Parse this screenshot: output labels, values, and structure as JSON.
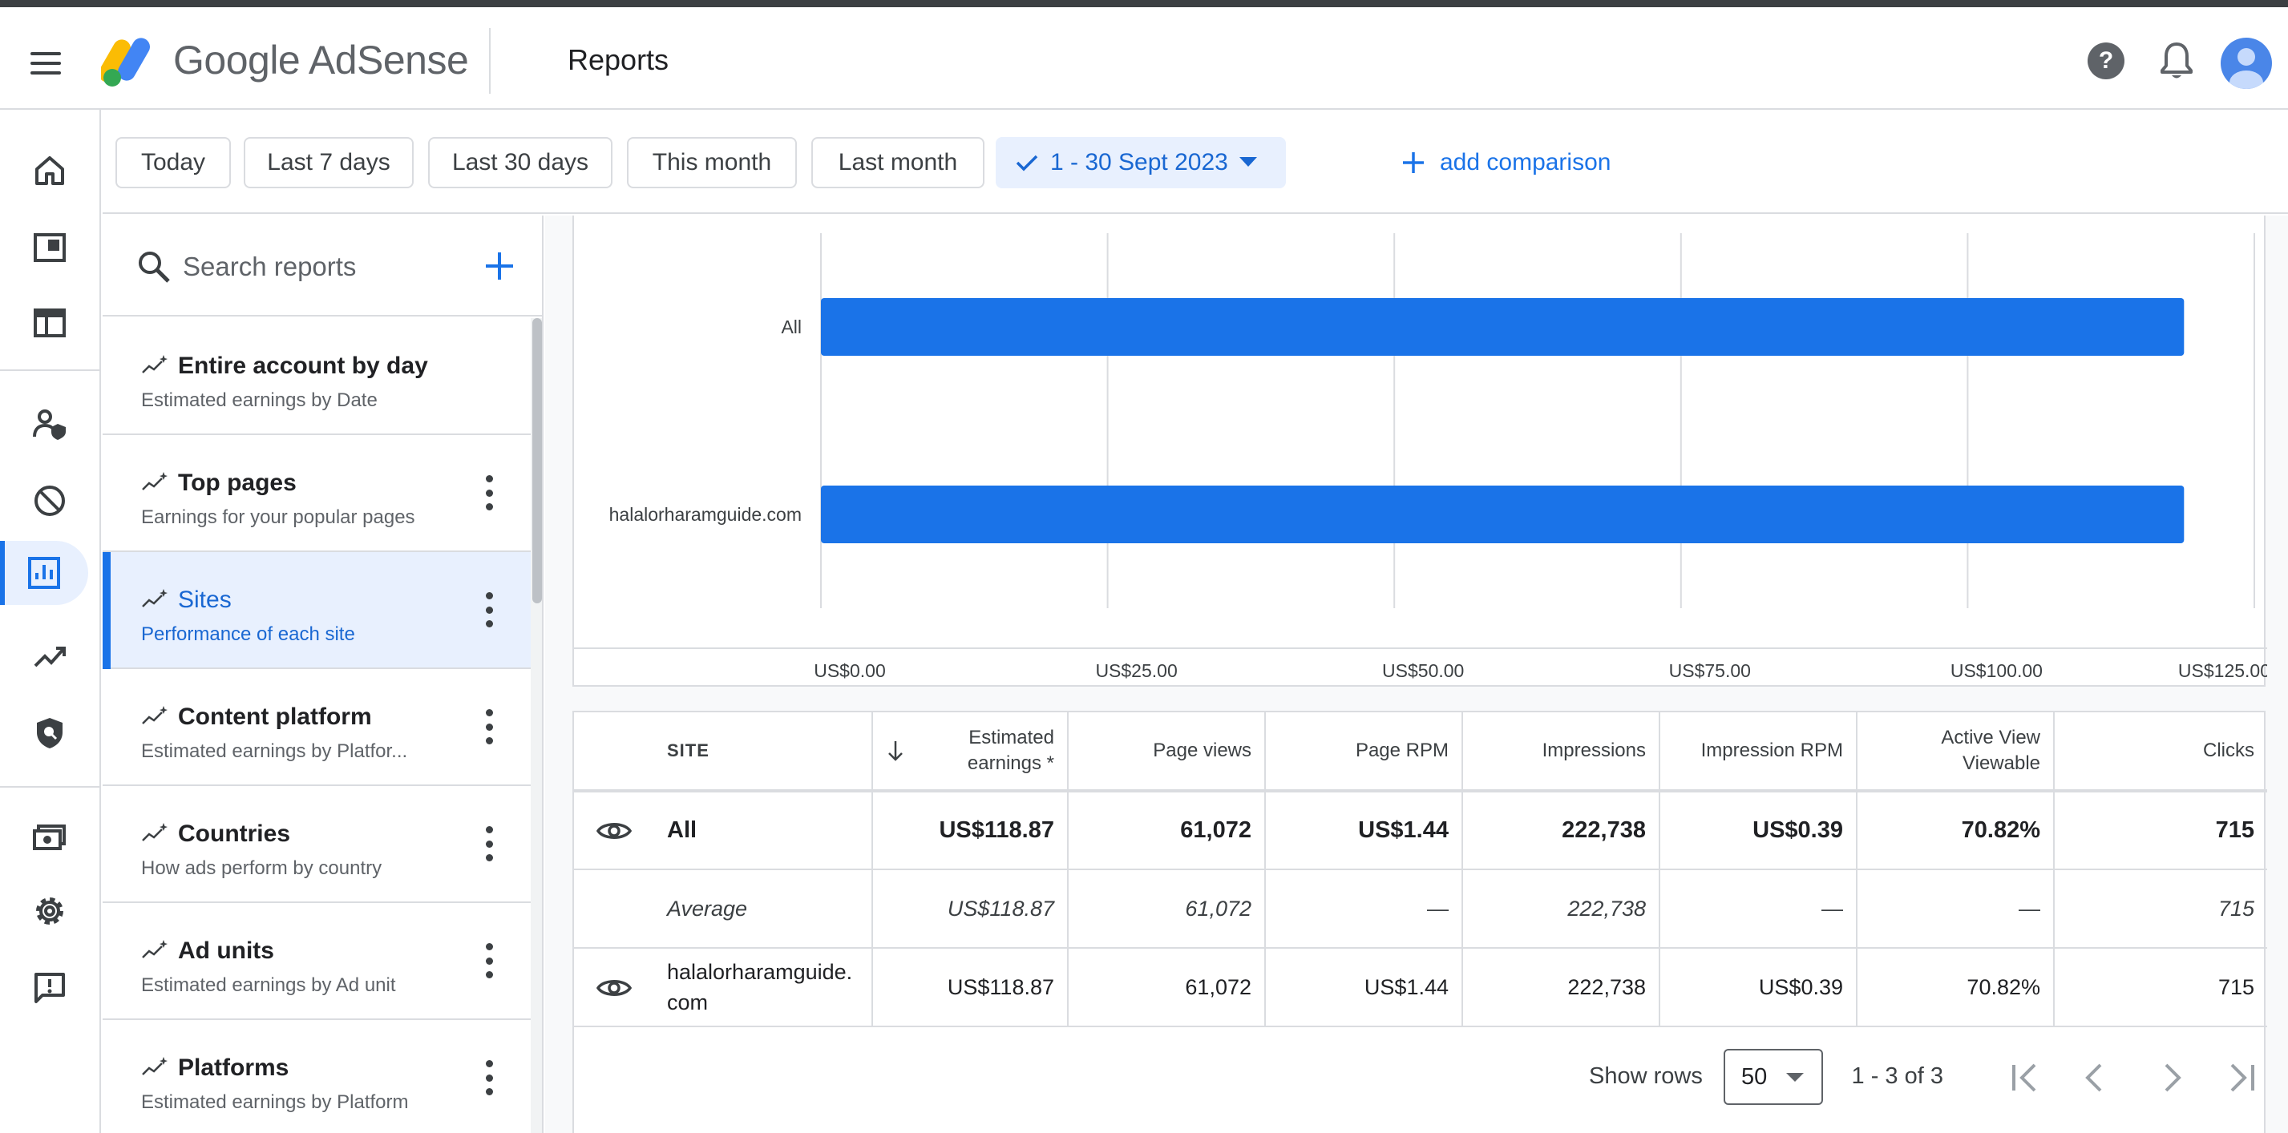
{
  "app": {
    "brand": "Google AdSense",
    "page_title": "Reports"
  },
  "filters": {
    "chips": [
      "Today",
      "Last 7 days",
      "Last 30 days",
      "This month",
      "Last month"
    ],
    "selected_range": "1 - 30 Sept 2023",
    "add_comparison": "add comparison"
  },
  "sidebar": {
    "search_placeholder": "Search reports",
    "reports": [
      {
        "title": "Entire account by day",
        "subtitle": "Estimated earnings by Date"
      },
      {
        "title": "Top pages",
        "subtitle": "Earnings for your popular pages"
      },
      {
        "title": "Sites",
        "subtitle": "Performance of each site"
      },
      {
        "title": "Content platform",
        "subtitle": "Estimated earnings by Platfor..."
      },
      {
        "title": "Countries",
        "subtitle": "How ads perform by country"
      },
      {
        "title": "Ad units",
        "subtitle": "Estimated earnings by Ad unit"
      },
      {
        "title": "Platforms",
        "subtitle": "Estimated earnings by Platform"
      }
    ],
    "active_index": 2
  },
  "rail_icons": [
    "home-icon",
    "ads-icon",
    "layout-icon",
    "privacy-messaging-icon",
    "blocking-controls-icon",
    "reports-icon",
    "optimization-icon",
    "policy-center-icon",
    "payments-icon",
    "settings-icon",
    "feedback-icon"
  ],
  "chart_data": {
    "type": "bar",
    "orientation": "horizontal",
    "categories": [
      "All",
      "halalorharamguide.com"
    ],
    "values": [
      118.87,
      118.87
    ],
    "xlim": [
      0,
      125
    ],
    "xticks": [
      "US$0.00",
      "US$25.00",
      "US$50.00",
      "US$75.00",
      "US$100.00",
      "US$125.00"
    ],
    "bar_color": "#1a73e8",
    "grid": true
  },
  "table": {
    "headers": {
      "site": "SITE",
      "estimated_earnings": "Estimated earnings *",
      "page_views": "Page views",
      "page_rpm": "Page RPM",
      "impressions": "Impressions",
      "impression_rpm": "Impression RPM",
      "active_view": "Active View Viewable",
      "clicks": "Clicks"
    },
    "rows": [
      {
        "site": "All",
        "estimated_earnings": "US$118.87",
        "page_views": "61,072",
        "page_rpm": "US$1.44",
        "impressions": "222,738",
        "impression_rpm": "US$0.39",
        "active_view": "70.82%",
        "clicks": "715"
      },
      {
        "site": "Average",
        "estimated_earnings": "US$118.87",
        "page_views": "61,072",
        "page_rpm": "—",
        "impressions": "222,738",
        "impression_rpm": "—",
        "active_view": "—",
        "clicks": "715"
      },
      {
        "site": "halalorharamguide.com",
        "estimated_earnings": "US$118.87",
        "page_views": "61,072",
        "page_rpm": "US$1.44",
        "impressions": "222,738",
        "impression_rpm": "US$0.39",
        "active_view": "70.82%",
        "clicks": "715"
      }
    ]
  },
  "pagination": {
    "show_rows_label": "Show rows",
    "rows_per_page": "50",
    "range": "1 - 3 of 3"
  },
  "colors": {
    "accent": "#1a73e8",
    "active_bg": "#e8f0fe"
  }
}
